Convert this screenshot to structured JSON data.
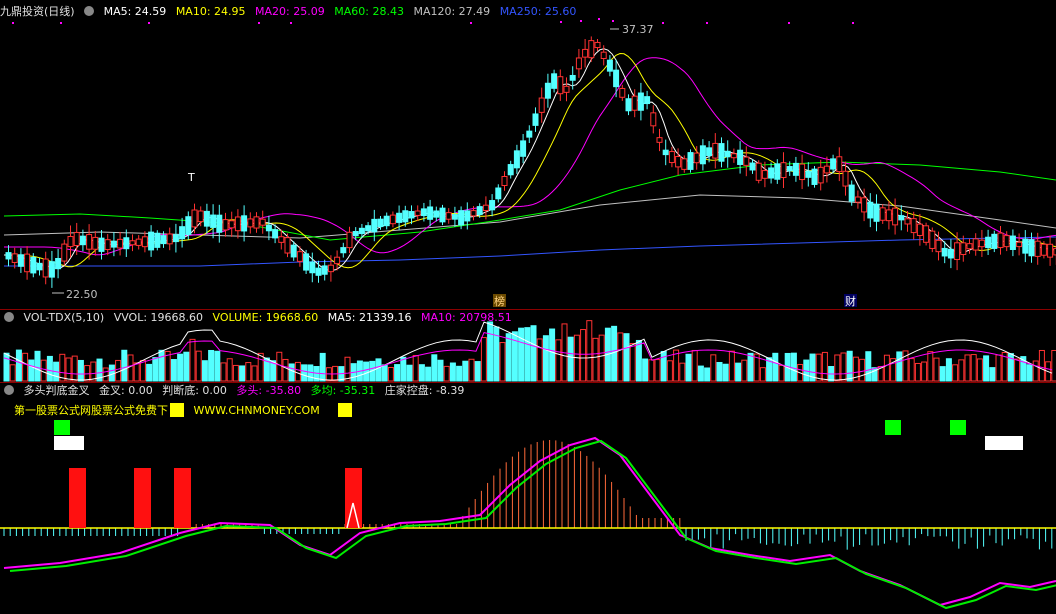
{
  "main_header": {
    "title": "九鼎投资(日线)",
    "items": [
      {
        "label": "MA5: 24.59",
        "color": "#ffffff"
      },
      {
        "label": "MA10: 24.95",
        "color": "#ffff00"
      },
      {
        "label": "MA20: 25.09",
        "color": "#ff00ff"
      },
      {
        "label": "MA60: 28.43",
        "color": "#00ff00"
      },
      {
        "label": "MA120: 27.49",
        "color": "#c0c0c0"
      },
      {
        "label": "MA250: 25.60",
        "color": "#3355ff"
      }
    ]
  },
  "annotations": {
    "high_label": "37.37",
    "low_label": "22.50",
    "t_marker": "T",
    "bang_marker": "榜",
    "cai_marker": "财"
  },
  "vol_header": {
    "title": "VOL-TDX(5,10)",
    "vvol": "VVOL: 19668.60",
    "volume": "VOLUME: 19668.60",
    "ma5": "MA5: 21339.16",
    "ma10": "MA10: 20798.51"
  },
  "ind_header": {
    "title": "多头判底金叉",
    "jincha": "金叉: 0.00",
    "panduandi": "判断底: 0.00",
    "duotou": "多头: -35.80",
    "duojun": "多均: -35.31",
    "zhuangjia": "庄家控盘: -8.39"
  },
  "promo": {
    "text": "第一股票公式网股票公式免费下",
    "url": "WWW.CHNMONEY.COM"
  },
  "chart_data": {
    "type": "candlestick",
    "title": "九鼎投资(日线)",
    "price_high": 37.37,
    "price_low": 22.5,
    "moving_averages": [
      "MA5",
      "MA10",
      "MA20",
      "MA60",
      "MA120",
      "MA250"
    ]
  },
  "colors": {
    "up": "#ff3232",
    "down": "#54ffff",
    "ma5": "#ffffff",
    "ma10": "#ffff00",
    "ma20": "#ff00ff",
    "ma60": "#00ff00",
    "ma120": "#c0c0c0",
    "ma250": "#3355ff",
    "separator": "#8b0000"
  }
}
